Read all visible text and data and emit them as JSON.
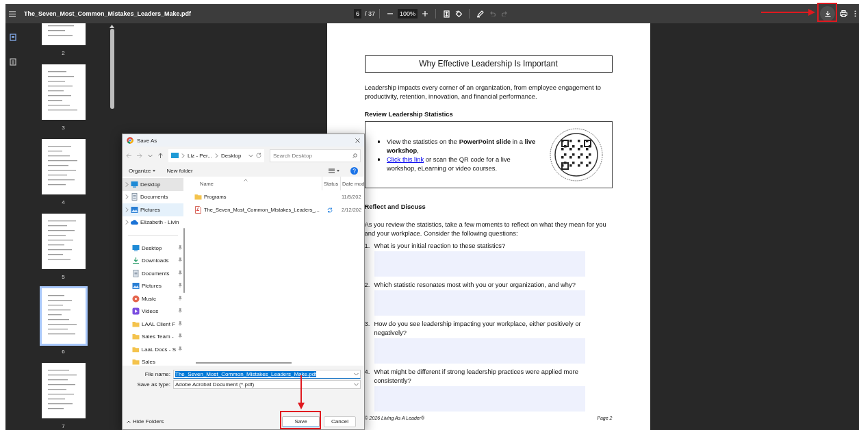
{
  "toolbar": {
    "file_name": "The_Seven_Most_Common_Mistakes_Leaders_Make.pdf",
    "page": "6",
    "page_count": "/ 37",
    "zoom": "100%",
    "undo_disabled": true,
    "redo_disabled": true
  },
  "sidebar": {
    "views": [
      {
        "kind": "thumbnails",
        "selected": true
      },
      {
        "kind": "outline",
        "selected": false
      }
    ],
    "thumbnails": [
      {
        "label": "2",
        "selected": false
      },
      {
        "label": "3",
        "selected": false
      },
      {
        "label": "4",
        "selected": false
      },
      {
        "label": "5",
        "selected": false
      },
      {
        "label": "6",
        "selected": true
      },
      {
        "label": "7",
        "selected": false
      }
    ]
  },
  "document": {
    "title": "Why Effective Leadership Is Important",
    "intro": "Leadership impacts every corner of an organization, from employee engagement to productivity, retention, innovation, and financial performance.",
    "heading_1": "Review Leadership Statistics",
    "bullets": [
      {
        "text": "View the statistics on the **PowerPoint slide** in a **live workshop**,"
      },
      {
        "link": "Click this link",
        "text": " or scan the QR code for a live workshop, eLearning or video courses."
      }
    ],
    "heading_2": "Reflect and Discuss",
    "paragraph": "As you review the statistics, take a few moments to reflect on what they mean for you and your workplace. Consider the following questions:",
    "questions": [
      {
        "number": "1.",
        "text": "What is your initial reaction to these statistics?"
      },
      {
        "number": "2.",
        "text": "Which statistic resonates most with you or your organization, and why?"
      },
      {
        "number": "3.",
        "text": "How do you see leadership impacting your workplace, either positively or negatively?"
      },
      {
        "number": "4.",
        "text": "What might be different if strong leadership practices were applied more consistently?"
      }
    ],
    "footer": "© 2026 Living As A Leader®",
    "page_label": "Page 2"
  },
  "dialog": {
    "title": "Save As",
    "path": [
      "Liz - Per...",
      "Desktop"
    ],
    "search_placeholder": "Search Desktop",
    "commands": [
      "Organize",
      "New folder"
    ],
    "nav_tree": [
      {
        "label": "Desktop",
        "kind": "desktop",
        "selected": true,
        "hovered": false
      },
      {
        "label": "Documents",
        "kind": "documents",
        "selected": false,
        "hovered": false
      },
      {
        "label": "Pictures",
        "kind": "pictures",
        "selected": false,
        "hovered": true
      },
      {
        "label": "Elizabeth - Livin",
        "kind": "cloud",
        "selected": false,
        "hovered": false
      }
    ],
    "quick_access": [
      {
        "label": "Desktop",
        "kind": "desktop",
        "pinned": true
      },
      {
        "label": "Downloads",
        "kind": "downloads",
        "pinned": true
      },
      {
        "label": "Documents",
        "kind": "documents",
        "pinned": true
      },
      {
        "label": "Pictures",
        "kind": "pictures",
        "pinned": true
      },
      {
        "label": "Music",
        "kind": "music",
        "pinned": true
      },
      {
        "label": "Videos",
        "kind": "videos",
        "pinned": true
      },
      {
        "label": "LAAL Client F",
        "kind": "folder",
        "pinned": true
      },
      {
        "label": "Sales Team -",
        "kind": "folder",
        "pinned": true
      },
      {
        "label": "LaaL Docs - S",
        "kind": "folder",
        "pinned": true
      },
      {
        "label": "Sales",
        "kind": "folder",
        "pinned": false
      }
    ],
    "columns": [
      "Name",
      "Status",
      "Date mod"
    ],
    "files": [
      {
        "kind": "folder",
        "name": "Programs",
        "syncing": false,
        "date": "11/5/202"
      },
      {
        "kind": "pdf",
        "name": "The_Seven_Most_Common_Mistakes_Leaders_...",
        "syncing": true,
        "date": "2/12/202"
      }
    ],
    "file_name_label": "File name:",
    "file_name": "The_Seven_Most_Common_Mistakes_Leaders_Make.pdf",
    "file_name_selected": true,
    "type_label": "Save as type:",
    "save_type": "Adobe Acrobat Document (*.pdf)",
    "hide_folders": "Hide Folders",
    "save": "Save",
    "cancel": "Cancel"
  }
}
